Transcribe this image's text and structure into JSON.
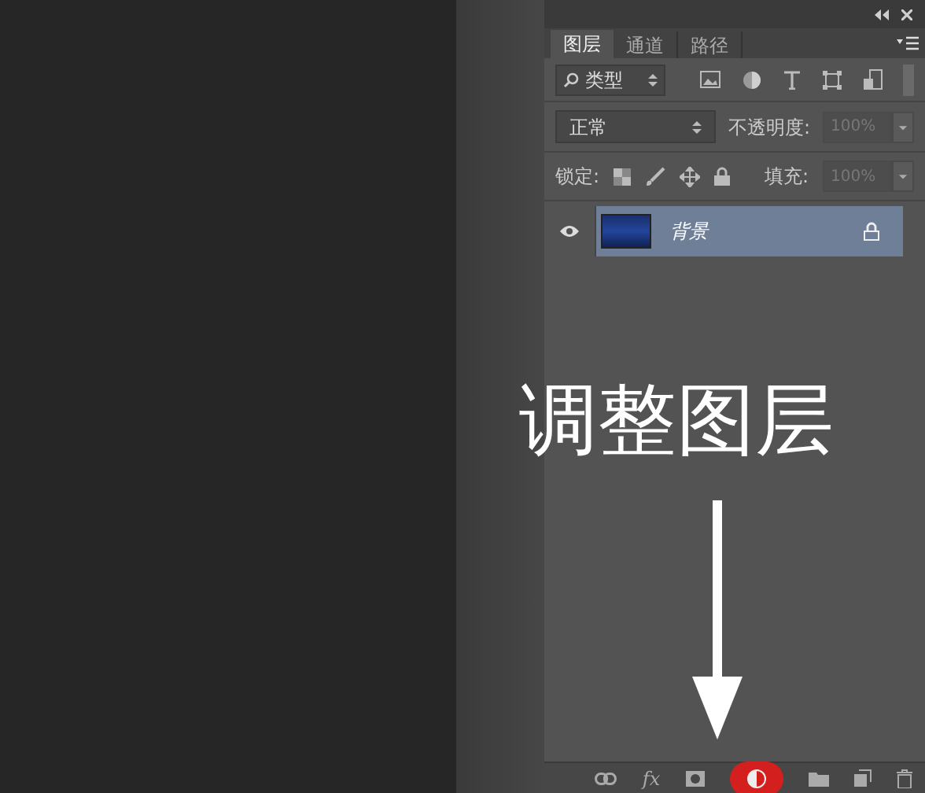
{
  "tabs": [
    {
      "label": "图层",
      "selected": true
    },
    {
      "label": "通道",
      "selected": false
    },
    {
      "label": "路径",
      "selected": false
    }
  ],
  "filter": {
    "value": "类型"
  },
  "blend_mode": {
    "value": "正常"
  },
  "opacity": {
    "label": "不透明度:",
    "value": "100%",
    "disabled": true
  },
  "lock": {
    "label": "锁定:"
  },
  "fill": {
    "label": "填充:",
    "value": "100%",
    "disabled": true
  },
  "layers": [
    {
      "name": "背景",
      "visible": true,
      "selected": true,
      "locked": true
    }
  ],
  "effects_button": {
    "label": "fx"
  },
  "annotation": {
    "text": "调整图层"
  }
}
